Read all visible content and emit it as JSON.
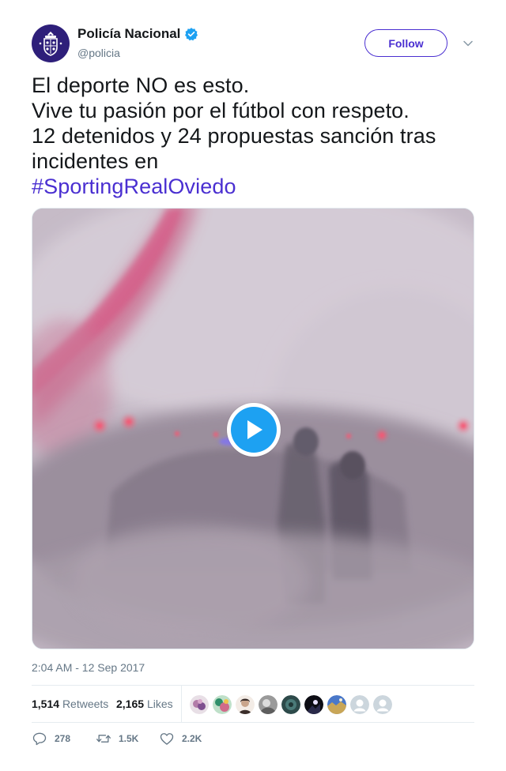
{
  "user": {
    "display_name": "Policía Nacional",
    "handle": "@policia",
    "verified": true,
    "avatar_icon": "police-crest-icon"
  },
  "follow_label": "Follow",
  "tweet": {
    "lines": [
      "El deporte NO es esto.",
      "Vive tu pasión por el fútbol con respeto.",
      "12 detenidos y 24 propuestas sanción tras",
      "incidentes en"
    ],
    "hashtag": "#SportingRealOviedo"
  },
  "media": {
    "type": "video",
    "play_icon": "play-icon"
  },
  "timestamp": "2:04 AM - 12 Sep 2017",
  "stats": {
    "retweets_count": "1,514",
    "retweets_label": "Retweets",
    "likes_count": "2,165",
    "likes_label": "Likes"
  },
  "actions": {
    "replies": "278",
    "retweets": "1.5K",
    "likes": "2.2K"
  },
  "colors": {
    "link": "#4a2fd1",
    "verified": "#1da1f2",
    "play": "#1da1f2",
    "text_secondary": "#657786"
  }
}
